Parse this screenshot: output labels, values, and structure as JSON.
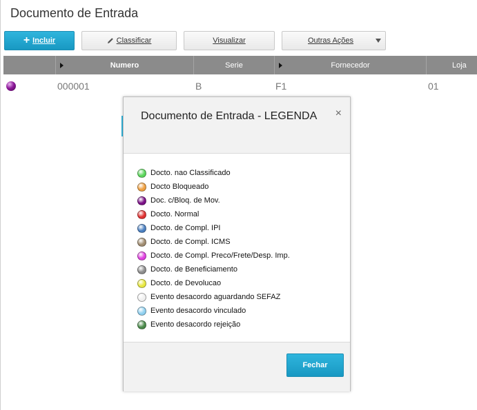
{
  "page": {
    "title": "Documento de Entrada"
  },
  "toolbar": {
    "incluir": "Incluir",
    "classificar": "Classificar",
    "visualizar": "Visualizar",
    "outras_acoes": "Outras Ações"
  },
  "grid": {
    "columns": [
      "Numero",
      "Serie",
      "Fornecedor",
      "Loja"
    ],
    "rows": [
      {
        "status_color": "#8e1a9a",
        "numero": "000001",
        "serie": "B",
        "fornecedor": "F1",
        "loja": "01"
      }
    ]
  },
  "modal": {
    "title": "Documento de Entrada - LEGENDA",
    "close_icon": "close-icon",
    "close_glyph": "×",
    "legend": [
      {
        "label": "Docto. nao Classificado",
        "color": "#5bd65b"
      },
      {
        "label": "Docto Bloqueado",
        "color": "#f0a040"
      },
      {
        "label": "Doc. c/Bloq. de Mov.",
        "color": "#7a0f86"
      },
      {
        "label": "Docto. Normal",
        "color": "#e03030"
      },
      {
        "label": "Docto. de Compl. IPI",
        "color": "#4a7fc0"
      },
      {
        "label": "Docto. de Compl. ICMS",
        "color": "#a08c70"
      },
      {
        "label": "Docto. de Compl. Preco/Frete/Desp. Imp.",
        "color": "#e040e0"
      },
      {
        "label": "Docto. de Beneficiamento",
        "color": "#8c8c8c"
      },
      {
        "label": "Docto. de Devolucao",
        "color": "#e8e840"
      },
      {
        "label": "Evento desacordo aguardando SEFAZ",
        "color": "#f0f0f0"
      },
      {
        "label": "Evento desacordo vinculado",
        "color": "#8fd0f0"
      },
      {
        "label": "Evento desacordo rejeição",
        "color": "#4a8a4a"
      }
    ],
    "close_button": "Fechar"
  },
  "colors": {
    "accent": "#1fa4cf",
    "header_gray": "#8b8b8b"
  }
}
